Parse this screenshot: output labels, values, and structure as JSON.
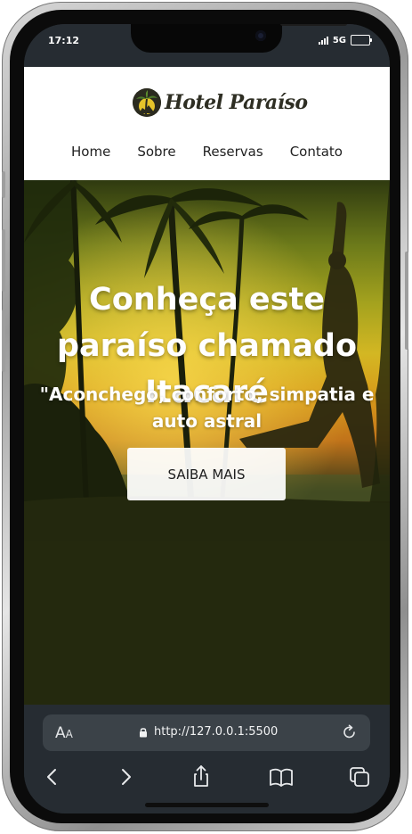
{
  "status_bar": {
    "time": "17:12",
    "network": "5G"
  },
  "site": {
    "logo_text": "Hotel Paraíso",
    "nav": [
      "Home",
      "Sobre",
      "Reservas",
      "Contato"
    ],
    "hero": {
      "title": "Conheça este paraíso chamado Itacaré",
      "subtitle": "\"Aconchego, conforto, simpatia e auto astral",
      "cta": "SAIBA MAIS"
    }
  },
  "browser": {
    "text_size_label": "A",
    "text_size_small": "A",
    "url": "http://127.0.0.1:5500"
  },
  "icons": {
    "back": "chevron-left-icon",
    "forward": "chevron-right-icon",
    "share": "share-icon",
    "bookmarks": "book-icon",
    "tabs": "tabs-icon",
    "reload": "reload-icon",
    "lock": "lock-icon"
  },
  "colors": {
    "browser_chrome": "#262c32",
    "header_bg": "#ffffff",
    "page_bottom": "#24290e",
    "sunset_gold": "#d3b723"
  }
}
